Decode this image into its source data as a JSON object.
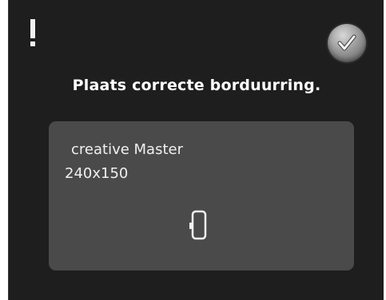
{
  "dialog": {
    "warning_icon": "exclamation-icon",
    "confirm_icon": "checkmark-icon",
    "title": "Plaats correcte borduurring.",
    "hoop": {
      "name": "creative Master",
      "size": "240x150",
      "icon": "embroidery-hoop-icon"
    }
  },
  "colors": {
    "background": "#1e1e1e",
    "panel": "#4a4a4a",
    "text": "#ffffff"
  }
}
